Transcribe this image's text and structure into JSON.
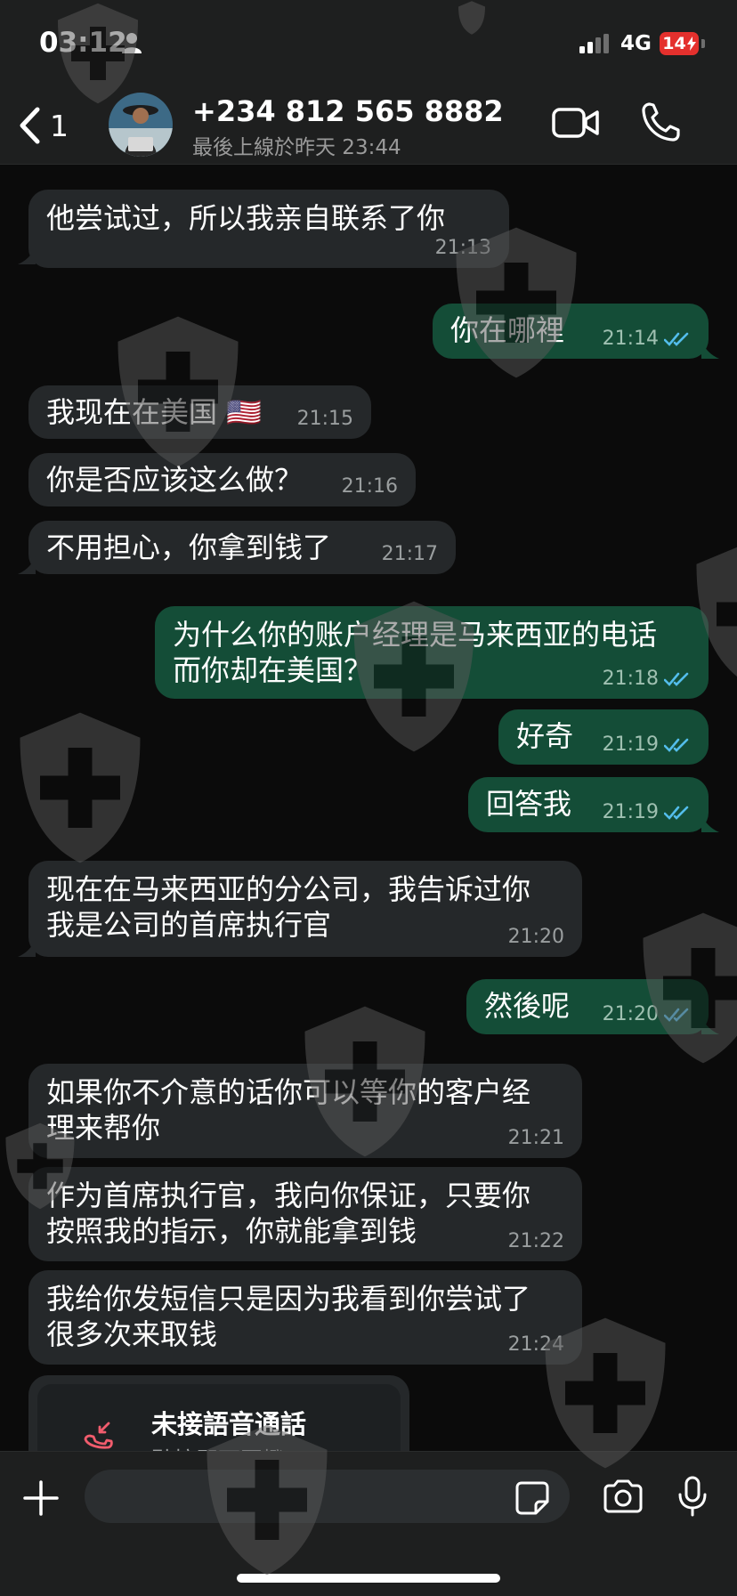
{
  "status_bar": {
    "time": "03:12",
    "network": "4G",
    "battery": "14"
  },
  "header": {
    "back_count": "1",
    "contact_name": "+234 812 565 8882",
    "last_seen": "最後上線於昨天 23:44"
  },
  "messages": [
    {
      "direction": "in",
      "text": "他尝试过，所以我亲自联系了你",
      "time": "21:13"
    },
    {
      "direction": "out",
      "text": "你在哪裡",
      "time": "21:14",
      "read": true
    },
    {
      "direction": "in",
      "text": "我现在在美国 🇺🇸",
      "time": "21:15"
    },
    {
      "direction": "in",
      "text": "你是否应该这么做？",
      "time": "21:16"
    },
    {
      "direction": "in",
      "text": "不用担心，你拿到钱了",
      "time": "21:17"
    },
    {
      "direction": "out",
      "text": "为什么你的账户经理是马来西亚的电话而你却在美国？",
      "time": "21:18",
      "read": true
    },
    {
      "direction": "out",
      "text": "好奇",
      "time": "21:19",
      "read": true
    },
    {
      "direction": "out",
      "text": "回答我",
      "time": "21:19",
      "read": true
    },
    {
      "direction": "in",
      "text": "现在在马来西亚的分公司，我告诉过你我是公司的首席执行官",
      "time": "21:20"
    },
    {
      "direction": "out",
      "text": "然後呢",
      "time": "21:20",
      "read": true
    },
    {
      "direction": "in",
      "text": "如果你不介意的话你可以等你的客户经理来帮你",
      "time": "21:21"
    },
    {
      "direction": "in",
      "text": "作为首席执行官，我向你保证，只要你按照我的指示，你就能拿到钱",
      "time": "21:22"
    },
    {
      "direction": "in",
      "text": "我给你发短信只是因为我看到你尝试了很多次来取钱",
      "time": "21:24"
    }
  ],
  "missed_call": {
    "title": "未接語音通話",
    "subtitle": "點按即可回撥"
  },
  "composer": {
    "placeholder": ""
  },
  "colors": {
    "incoming_bubble": "#25282a",
    "outgoing_bubble": "#144d37",
    "read_ticks": "#53bdeb",
    "missed_call": "#f15c6d"
  }
}
